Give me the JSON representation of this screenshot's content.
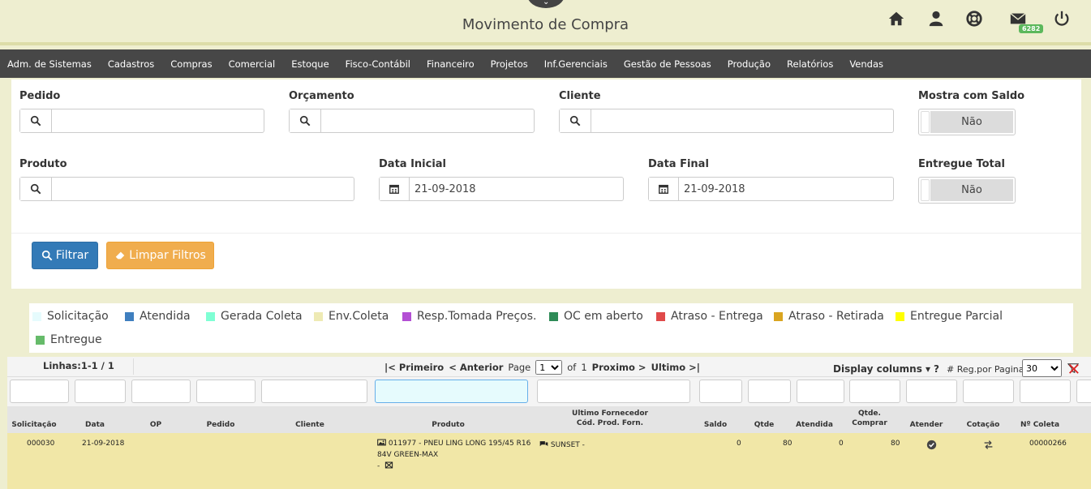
{
  "header": {
    "title": "Movimento de Compra",
    "mail_badge": "6282"
  },
  "menu": [
    "Adm. de Sistemas",
    "Cadastros",
    "Compras",
    "Comercial",
    "Estoque",
    "Fisco-Contábil",
    "Financeiro",
    "Projetos",
    "Inf.Gerenciais",
    "Gestão de Pessoas",
    "Produção",
    "Relatórios",
    "Vendas"
  ],
  "filters": {
    "pedido_label": "Pedido",
    "orcamento_label": "Orçamento",
    "cliente_label": "Cliente",
    "mostra_saldo_label": "Mostra com Saldo",
    "mostra_saldo_value": "Não",
    "produto_label": "Produto",
    "data_inicial_label": "Data Inicial",
    "data_inicial_value": "21-09-2018",
    "data_final_label": "Data Final",
    "data_final_value": "21-09-2018",
    "entregue_total_label": "Entregue Total",
    "entregue_total_value": "Não",
    "filtrar_button": "Filtrar",
    "limpar_button": "Limpar Filtros"
  },
  "legend": [
    {
      "label": "Solicitação",
      "color": "#e6fbfd"
    },
    {
      "label": "Atendida",
      "color": "#3f7fbf"
    },
    {
      "label": "Gerada Coleta",
      "color": "#7fffd4"
    },
    {
      "label": "Env.Coleta",
      "color": "#eeeab4"
    },
    {
      "label": "Resp.Tomada Preços.",
      "color": "#b34fd4"
    },
    {
      "label": "OC em aberto",
      "color": "#2e8b57"
    },
    {
      "label": "Atraso - Entrega",
      "color": "#e04a4a"
    },
    {
      "label": "Atraso - Retirada",
      "color": "#daa520"
    },
    {
      "label": "Entregue Parcial",
      "color": "#ffff00"
    },
    {
      "label": "Entregue",
      "color": "#66bb6a"
    }
  ],
  "pager": {
    "lines": "Linhas:1-1 / 1",
    "first": "|< Primeiro",
    "prev": "< Anterior",
    "page_label": "Page",
    "page_value": "1",
    "of_label": "of",
    "total_pages": "1",
    "next": "Proximo >",
    "last": "Ultimo >|",
    "display_columns": "Display columns ▾",
    "help": "?",
    "reg_por_pagina": "# Reg.por Pagina",
    "reg_value": "30"
  },
  "columns": [
    "Solicitação",
    "Data",
    "OP",
    "Pedido",
    "Cliente",
    "Produto",
    "Ultimo Fornecedor",
    "Cód. Prod. Forn.",
    "Saldo",
    "Qtde",
    "Atendida",
    "Qtde.",
    "Comprar",
    "Atender",
    "Cotação",
    "Nº Coleta"
  ],
  "rows": [
    {
      "solicitacao": "000030",
      "data": "21-09-2018",
      "op": "",
      "pedido": "",
      "cliente": "",
      "produto_line1": "011977 - PNEU LING LONG 195/45 R16",
      "produto_line2": "84V GREEN-MAX",
      "produto_line3": "-",
      "fornecedor": "SUNSET -",
      "saldo": "0",
      "qtde": "80",
      "atendida": "0",
      "qtde_comprar": "80",
      "coleta": "00000266"
    }
  ]
}
